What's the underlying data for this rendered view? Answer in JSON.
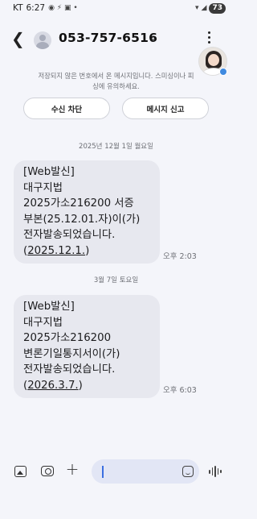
{
  "status_bar": {
    "carrier": "KT",
    "time": "6:27",
    "battery": "73"
  },
  "header": {
    "phone_number": "053-757-6516"
  },
  "notice": {
    "text": "저장되지 않은 번호에서 온 메시지입니다. 스미싱이나 피싱에 유의하세요."
  },
  "actions": {
    "block_label": "수신 차단",
    "report_label": "메시지 신고"
  },
  "conversation": [
    {
      "date": "2025년 12월 1일 월요일",
      "lines": [
        "[Web발신]",
        "대구지법",
        "2025가소216200 서증",
        "부본(25.12.01.자)이(가)",
        "전자발송되었습니다."
      ],
      "link": "2025.12.1.",
      "time": "오후 2:03"
    },
    {
      "date": "3월 7일 토요일",
      "lines": [
        "[Web발신]",
        "대구지법",
        "2025가소216200",
        "변론기일통지서이(가)",
        "전자발송되었습니다."
      ],
      "link": "2026.3.7.",
      "time": "오후 6:03"
    }
  ]
}
